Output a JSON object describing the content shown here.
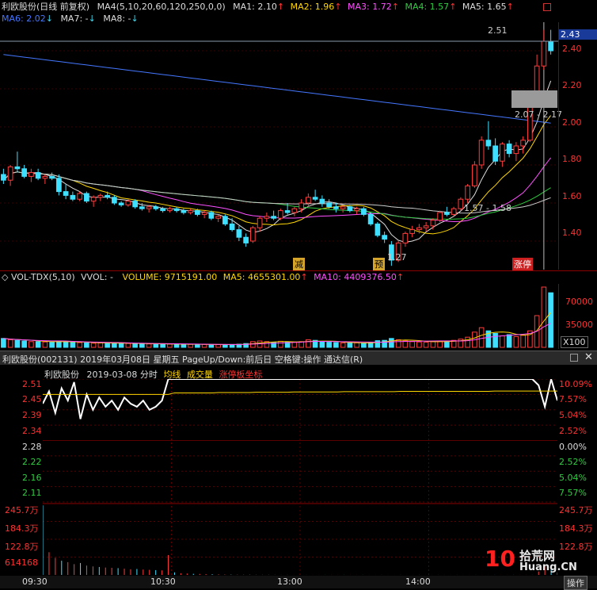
{
  "kline_header": {
    "title": "利欧股份(日线 前复权)",
    "ma4": {
      "label": "MA4(5,10,20,60,120,250,0,0)",
      "color": "#dddddd"
    },
    "ma1": {
      "label": "MA1: 2.10",
      "color": "#dddddd"
    },
    "ma2": {
      "label": "MA2: 1.96",
      "color": "#ffd700"
    },
    "ma3": {
      "label": "MA3: 1.72",
      "color": "#ff4fff"
    },
    "ma4v": {
      "label": "MA4: 1.57",
      "color": "#2ecc40"
    },
    "ma5": {
      "label": "MA5: 1.65",
      "color": "#dddddd"
    },
    "ma6": {
      "label": "MA6: 2.02",
      "color": "#4477ff"
    },
    "ma7": {
      "label": "MA7: -",
      "color": "#dddddd"
    },
    "ma8": {
      "label": "MA8: -",
      "color": "#dddddd"
    },
    "arrows": [
      "↑",
      "↑",
      "↑",
      "↑",
      "↑",
      "↑",
      "↓",
      "↓"
    ]
  },
  "kline_axis": {
    "current_price": "2.43",
    "ticks": [
      "2.40",
      "2.20",
      "2.00",
      "1.80",
      "1.60",
      "1.40"
    ]
  },
  "kline_annotations": {
    "high_label": "2.51",
    "low_label": "1.27",
    "range_label": "2.07 - 2.17",
    "range_label2": "1.57 - 1.58",
    "tag_jian": "减",
    "tag_yu": "预",
    "tag_zhangting": "涨停"
  },
  "volume_header": {
    "title": "VOL-TDX(5,10)",
    "vvol": "VVOL: -",
    "volume": "VOLUME: 9715191.00",
    "ma5": "MA5: 4655301.00",
    "ma10": "MA10: 4409376.50",
    "arrow": "↑"
  },
  "volume_axis": {
    "ticks": [
      "70000",
      "35000"
    ],
    "unit": "X100"
  },
  "intraday_header": {
    "title": "利欧股份(002131) 2019年03月08日 星期五 PageUp/Down:前后日 空格键:操作 通达信(R)"
  },
  "intraday_subheader": {
    "name": "利欧股份",
    "date": "2019-03-08 分时",
    "avg": "均线",
    "vol": "成交量",
    "limit": "涨停板坐标"
  },
  "intraday_axis": {
    "left_ticks": [
      "2.51",
      "2.45",
      "2.39",
      "2.34",
      "2.28",
      "2.22",
      "2.16",
      "2.11"
    ],
    "right_ticks": [
      "10.09%",
      "7.57%",
      "5.04%",
      "2.52%",
      "0.00%",
      "2.52%",
      "5.04%",
      "7.57%"
    ],
    "vol_left_ticks": [
      "245.7万",
      "184.3万",
      "122.8万",
      "614168"
    ],
    "vol_right_ticks": [
      "245.7万",
      "184.3万",
      "122.8万"
    ],
    "time_ticks": [
      "09:30",
      "10:30",
      "13:00",
      "14:00"
    ]
  },
  "watermark": {
    "brand": "10",
    "text1": "拾荒网",
    "text2": "Huang.CN"
  },
  "bottom_bar": {
    "action": "操作"
  },
  "chart_data": [
    {
      "type": "candlestick",
      "title": "利欧股份(日线 前复权)",
      "ylim": [
        1.25,
        2.55
      ],
      "candles": [
        [
          1.75,
          1.78,
          1.7,
          1.72
        ],
        [
          1.72,
          1.8,
          1.69,
          1.79
        ],
        [
          1.79,
          1.87,
          1.76,
          1.78
        ],
        [
          1.78,
          1.8,
          1.73,
          1.74
        ],
        [
          1.74,
          1.78,
          1.71,
          1.76
        ],
        [
          1.76,
          1.78,
          1.72,
          1.73
        ],
        [
          1.73,
          1.75,
          1.7,
          1.74
        ],
        [
          1.74,
          1.76,
          1.72,
          1.73
        ],
        [
          1.73,
          1.75,
          1.64,
          1.66
        ],
        [
          1.66,
          1.7,
          1.62,
          1.64
        ],
        [
          1.64,
          1.66,
          1.61,
          1.62
        ],
        [
          1.62,
          1.66,
          1.61,
          1.65
        ],
        [
          1.65,
          1.66,
          1.6,
          1.61
        ],
        [
          1.61,
          1.64,
          1.58,
          1.63
        ],
        [
          1.63,
          1.65,
          1.61,
          1.64
        ],
        [
          1.64,
          1.66,
          1.62,
          1.63
        ],
        [
          1.63,
          1.64,
          1.59,
          1.6
        ],
        [
          1.6,
          1.61,
          1.58,
          1.59
        ],
        [
          1.59,
          1.62,
          1.58,
          1.61
        ],
        [
          1.61,
          1.62,
          1.57,
          1.58
        ],
        [
          1.58,
          1.6,
          1.56,
          1.57
        ],
        [
          1.57,
          1.59,
          1.55,
          1.58
        ],
        [
          1.58,
          1.59,
          1.56,
          1.57
        ],
        [
          1.57,
          1.58,
          1.55,
          1.56
        ],
        [
          1.56,
          1.58,
          1.55,
          1.57
        ],
        [
          1.57,
          1.58,
          1.55,
          1.56
        ],
        [
          1.56,
          1.57,
          1.54,
          1.55
        ],
        [
          1.55,
          1.57,
          1.54,
          1.56
        ],
        [
          1.56,
          1.57,
          1.53,
          1.54
        ],
        [
          1.54,
          1.56,
          1.52,
          1.55
        ],
        [
          1.55,
          1.56,
          1.51,
          1.52
        ],
        [
          1.52,
          1.54,
          1.5,
          1.53
        ],
        [
          1.53,
          1.54,
          1.48,
          1.49
        ],
        [
          1.49,
          1.52,
          1.45,
          1.46
        ],
        [
          1.46,
          1.48,
          1.4,
          1.42
        ],
        [
          1.42,
          1.44,
          1.37,
          1.39
        ],
        [
          1.4,
          1.48,
          1.39,
          1.47
        ],
        [
          1.47,
          1.53,
          1.45,
          1.52
        ],
        [
          1.52,
          1.55,
          1.5,
          1.53
        ],
        [
          1.53,
          1.56,
          1.51,
          1.52
        ],
        [
          1.52,
          1.57,
          1.51,
          1.56
        ],
        [
          1.56,
          1.6,
          1.54,
          1.55
        ],
        [
          1.55,
          1.58,
          1.53,
          1.57
        ],
        [
          1.57,
          1.62,
          1.55,
          1.6
        ],
        [
          1.6,
          1.65,
          1.58,
          1.63
        ],
        [
          1.63,
          1.67,
          1.61,
          1.62
        ],
        [
          1.62,
          1.64,
          1.58,
          1.6
        ],
        [
          1.6,
          1.62,
          1.57,
          1.58
        ],
        [
          1.58,
          1.6,
          1.55,
          1.57
        ],
        [
          1.57,
          1.59,
          1.55,
          1.58
        ],
        [
          1.58,
          1.59,
          1.55,
          1.56
        ],
        [
          1.56,
          1.58,
          1.54,
          1.57
        ],
        [
          1.57,
          1.58,
          1.53,
          1.54
        ],
        [
          1.54,
          1.55,
          1.48,
          1.49
        ],
        [
          1.49,
          1.5,
          1.42,
          1.43
        ],
        [
          1.43,
          1.45,
          1.39,
          1.41
        ],
        [
          1.38,
          1.4,
          1.27,
          1.3
        ],
        [
          1.3,
          1.4,
          1.29,
          1.39
        ],
        [
          1.39,
          1.45,
          1.37,
          1.44
        ],
        [
          1.44,
          1.48,
          1.42,
          1.46
        ],
        [
          1.46,
          1.49,
          1.44,
          1.47
        ],
        [
          1.47,
          1.5,
          1.45,
          1.48
        ],
        [
          1.48,
          1.52,
          1.46,
          1.51
        ],
        [
          1.51,
          1.56,
          1.5,
          1.55
        ],
        [
          1.55,
          1.58,
          1.53,
          1.54
        ],
        [
          1.54,
          1.58,
          1.53,
          1.57
        ],
        [
          1.57,
          1.63,
          1.56,
          1.62
        ],
        [
          1.62,
          1.7,
          1.6,
          1.69
        ],
        [
          1.69,
          1.82,
          1.68,
          1.8
        ],
        [
          1.8,
          1.95,
          1.78,
          1.93
        ],
        [
          1.93,
          2.03,
          1.88,
          1.9
        ],
        [
          1.9,
          1.94,
          1.8,
          1.82
        ],
        [
          1.82,
          1.92,
          1.79,
          1.91
        ],
        [
          1.91,
          1.93,
          1.84,
          1.86
        ],
        [
          1.86,
          1.92,
          1.82,
          1.9
        ],
        [
          1.9,
          1.95,
          1.86,
          1.93
        ],
        [
          1.93,
          2.11,
          1.92,
          2.11
        ],
        [
          2.11,
          2.38,
          2.1,
          2.32
        ],
        [
          2.32,
          2.51,
          2.3,
          2.45
        ],
        [
          2.45,
          2.51,
          2.38,
          2.4
        ]
      ],
      "ma_labels": [
        "MA1",
        "MA2",
        "MA3",
        "MA4",
        "MA5",
        "MA6"
      ],
      "gap_zone": [
        2.07,
        2.17
      ],
      "annotations": {
        "high": 2.51,
        "low": 1.27
      }
    },
    {
      "type": "bar",
      "title": "VOL-TDX(5,10)",
      "unit": "X100",
      "ylim": [
        0,
        100000
      ],
      "volumes": [
        14000,
        12000,
        11000,
        10000,
        9000,
        9000,
        8500,
        8000,
        10000,
        9000,
        8000,
        7500,
        7000,
        6500,
        7000,
        6800,
        6500,
        6000,
        6200,
        5800,
        5600,
        5400,
        5200,
        5000,
        5100,
        4900,
        4800,
        4700,
        4600,
        4500,
        4400,
        4300,
        4200,
        4500,
        5000,
        6000,
        9000,
        10000,
        9000,
        8000,
        9500,
        8500,
        8000,
        9000,
        12000,
        11000,
        9000,
        8000,
        7500,
        7000,
        6800,
        7200,
        6500,
        8000,
        10500,
        11000,
        14000,
        12000,
        10000,
        9000,
        8500,
        8200,
        9000,
        10000,
        9500,
        11000,
        13000,
        16000,
        24000,
        31000,
        26000,
        22000,
        18000,
        20000,
        17000,
        19000,
        26000,
        50000,
        95000,
        86000
      ]
    },
    {
      "type": "line",
      "title": "利欧股份 2019-03-08 分时",
      "ylim": [
        2.11,
        2.51
      ],
      "pre_close": 2.28,
      "time_ticks": [
        "09:30",
        "10:30",
        "13:00",
        "14:00"
      ],
      "price": [
        2.43,
        2.47,
        2.4,
        2.48,
        2.44,
        2.5,
        2.38,
        2.46,
        2.41,
        2.45,
        2.42,
        2.44,
        2.41,
        2.45,
        2.43,
        2.42,
        2.44,
        2.41,
        2.42,
        2.44,
        2.51,
        2.51,
        2.51,
        2.51,
        2.51,
        2.51,
        2.51,
        2.51,
        2.51,
        2.51,
        2.51,
        2.51,
        2.51,
        2.51,
        2.51,
        2.51,
        2.51,
        2.51,
        2.51,
        2.51,
        2.51,
        2.51,
        2.51,
        2.51,
        2.51,
        2.51,
        2.51,
        2.51,
        2.51,
        2.51,
        2.51,
        2.51,
        2.51,
        2.51,
        2.51,
        2.51,
        2.51,
        2.51,
        2.51,
        2.51,
        2.51,
        2.51,
        2.51,
        2.51,
        2.51,
        2.51,
        2.51,
        2.51,
        2.51,
        2.51,
        2.51,
        2.51,
        2.51,
        2.51,
        2.51,
        2.51,
        2.51,
        2.51,
        2.51,
        2.49,
        2.42,
        2.51,
        2.44
      ],
      "avg": [
        2.46,
        2.46,
        2.46,
        2.46,
        2.46,
        2.46,
        2.46,
        2.46,
        2.46,
        2.46,
        2.46,
        2.46,
        2.46,
        2.46,
        2.46,
        2.46,
        2.46,
        2.46,
        2.46,
        2.46,
        2.46,
        2.465,
        2.465,
        2.465,
        2.465,
        2.465,
        2.465,
        2.465,
        2.466,
        2.466,
        2.466,
        2.466,
        2.466,
        2.466,
        2.467,
        2.467,
        2.467,
        2.467,
        2.467,
        2.467,
        2.468,
        2.468,
        2.468,
        2.468,
        2.468,
        2.468,
        2.468,
        2.468,
        2.469,
        2.469,
        2.469,
        2.469,
        2.469,
        2.469,
        2.469,
        2.469,
        2.469,
        2.47,
        2.47,
        2.47,
        2.47,
        2.47,
        2.47,
        2.47,
        2.47,
        2.47,
        2.47,
        2.47,
        2.47,
        2.47,
        2.47,
        2.47,
        2.471,
        2.471,
        2.471,
        2.471,
        2.471,
        2.471,
        2.471,
        2.471,
        2.471,
        2.471,
        2.471
      ],
      "volume_ylim": [
        0,
        2457000
      ],
      "volume": [
        2450000,
        800000,
        600000,
        500000,
        450000,
        380000,
        420000,
        330000,
        300000,
        280000,
        260000,
        250000,
        240000,
        220000,
        200000,
        210000,
        190000,
        180000,
        170000,
        160000,
        700000,
        90000,
        60000,
        50000,
        40000,
        35000,
        30000,
        25000,
        20000,
        15000,
        12000,
        10000,
        9000,
        8000,
        7000,
        6000,
        5000,
        4000,
        3000,
        2500,
        2000,
        2000,
        2000,
        2000,
        2000,
        2000,
        2000,
        2000,
        2000,
        2000,
        2000,
        2000,
        2000,
        2000,
        2000,
        2000,
        2000,
        2000,
        2000,
        2000,
        2000,
        2000,
        2000,
        2000,
        2000,
        2000,
        2000,
        2000,
        2000,
        2000,
        2000,
        2000,
        2000,
        2000,
        2000,
        2000,
        2000,
        2000,
        2000,
        120000,
        350000,
        260000,
        90000
      ]
    }
  ]
}
